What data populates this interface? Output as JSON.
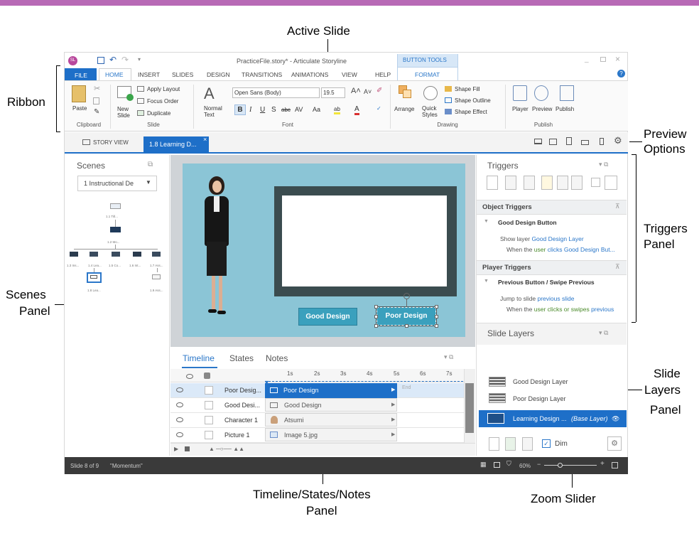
{
  "callouts": {
    "active_slide": "Active Slide",
    "ribbon": "Ribbon",
    "preview_line1": "Preview",
    "preview_line2": "Options",
    "triggers_line1": "Triggers",
    "triggers_line2": "Panel",
    "scenes_line1": "Scenes",
    "scenes_line2": "Panel",
    "layers_line1": "Slide",
    "layers_line2": "Layers",
    "layers_line3": "Panel",
    "tsn_line1": "Timeline/States/Notes",
    "tsn_line2": "Panel",
    "zoom": "Zoom Slider"
  },
  "titlebar": {
    "title": "PracticeFile.story* - Articulate Storyline",
    "button_tools": "BUTTON TOOLS",
    "format": "FORMAT"
  },
  "tabs": [
    "FILE",
    "HOME",
    "INSERT",
    "SLIDES",
    "DESIGN",
    "TRANSITIONS",
    "ANIMATIONS",
    "VIEW",
    "HELP"
  ],
  "ribbon": {
    "paste": "Paste",
    "clipboard": "Clipboard",
    "new_slide": "New Slide",
    "apply_layout": "Apply Layout",
    "focus_order": "Focus Order",
    "duplicate": "Duplicate",
    "slide": "Slide",
    "normal_text": "Normal Text",
    "font_name": "Open Sans (Body)",
    "font_size": "19.5",
    "font": "Font",
    "arrange": "Arrange",
    "quick_styles": "Quick Styles",
    "shape_fill": "Shape Fill",
    "shape_outline": "Shape Outline",
    "shape_effect": "Shape Effect",
    "drawing": "Drawing",
    "player": "Player",
    "preview": "Preview",
    "publish": "Publish",
    "publish_group": "Publish"
  },
  "doc_tabs": {
    "story_view": "STORY VIEW",
    "current": "1.8 Learning D..."
  },
  "scenes": {
    "title": "Scenes",
    "dropdown": "1 Instructional De",
    "nodes": [
      "1.1 Titl...",
      "1.2 Mo...",
      "1.3 Ins...",
      "1.4 Lea...",
      "1.5 Co...",
      "1.6 Int...",
      "1.7 Ass...",
      "1.8 Lea...",
      "1.9 Ass..."
    ]
  },
  "slide": {
    "good_btn": "Good Design",
    "poor_btn": "Poor Design"
  },
  "triggers": {
    "title": "Triggers",
    "object_triggers": "Object Triggers",
    "good_design_button": "Good Design Button",
    "show_layer": "Show layer",
    "good_design_layer": "Good Design Layer",
    "when_the": "When the",
    "user": "user",
    "clicks": "clicks",
    "good_design_but": "Good Design But...",
    "player_triggers": "Player Triggers",
    "prev_swipe": "Previous Button / Swipe Previous",
    "jump_to_slide": "Jump to slide",
    "previous_slide": "previous slide",
    "user_clicks_or_swipes": "user clicks or swipes",
    "previous": "previous"
  },
  "layers": {
    "title": "Slide Layers",
    "items": [
      "Good Design Layer",
      "Poor Design Layer"
    ],
    "base_name": "Learning Design ...",
    "base_tag": "(Base Layer)",
    "dim": "Dim"
  },
  "timeline": {
    "tabs": [
      "Timeline",
      "States",
      "Notes"
    ],
    "ticks": [
      "1s",
      "2s",
      "3s",
      "4s",
      "5s",
      "6s",
      "7s"
    ],
    "end": "End",
    "rows": [
      {
        "name": "Poor Desig...",
        "bar": "Poor Design"
      },
      {
        "name": "Good Desi...",
        "bar": "Good Design"
      },
      {
        "name": "Character 1",
        "bar": "Atsumi"
      },
      {
        "name": "Picture 1",
        "bar": "Image 5.jpg"
      }
    ]
  },
  "status": {
    "slide_of": "Slide 8 of 9",
    "theme": "\"Momentum\"",
    "zoom": "60%"
  }
}
